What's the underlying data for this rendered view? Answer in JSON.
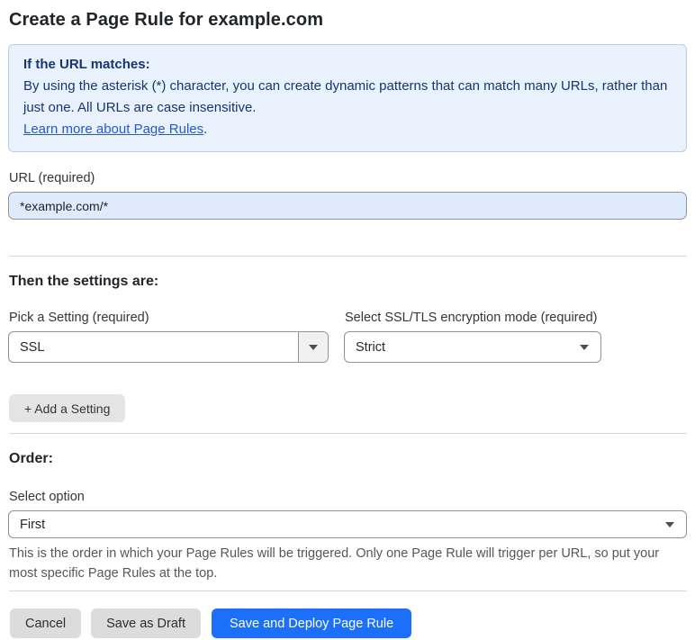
{
  "page": {
    "title": "Create a Page Rule for example.com"
  },
  "info_box": {
    "heading": "If the URL matches:",
    "body": "By using the asterisk (*) character, you can create dynamic patterns that can match many URLs, rather than just one. All URLs are case insensitive.",
    "link_label": "Learn more about Page Rules",
    "link_suffix": "."
  },
  "url_field": {
    "label": "URL (required)",
    "value": "*example.com/*"
  },
  "settings_section": {
    "heading": "Then the settings are:",
    "setting_select": {
      "label": "Pick a Setting (required)",
      "value": "SSL"
    },
    "mode_select": {
      "label": "Select SSL/TLS encryption mode (required)",
      "value": "Strict"
    },
    "add_setting_label": "+ Add a Setting"
  },
  "order_section": {
    "heading": "Order:",
    "select_label": "Select option",
    "value": "First",
    "help_text": "This is the order in which your Page Rules will be triggered. Only one Page Rule will trigger per URL, so put your most specific Page Rules at the top."
  },
  "footer": {
    "cancel_label": "Cancel",
    "save_draft_label": "Save as Draft",
    "save_deploy_label": "Save and Deploy Page Rule"
  },
  "colors": {
    "accent_blue": "#1b6ff8",
    "info_bg": "#e9f2fc",
    "info_border": "#b7cfec",
    "info_text": "#17356f",
    "link_blue": "#2458d5",
    "input_bg": "#dfeafd",
    "border_gray": "#8e9499",
    "divider": "#d9d9d9",
    "btn_gray": "#dcdcdc"
  },
  "icons": {
    "caret": "caret-down"
  }
}
